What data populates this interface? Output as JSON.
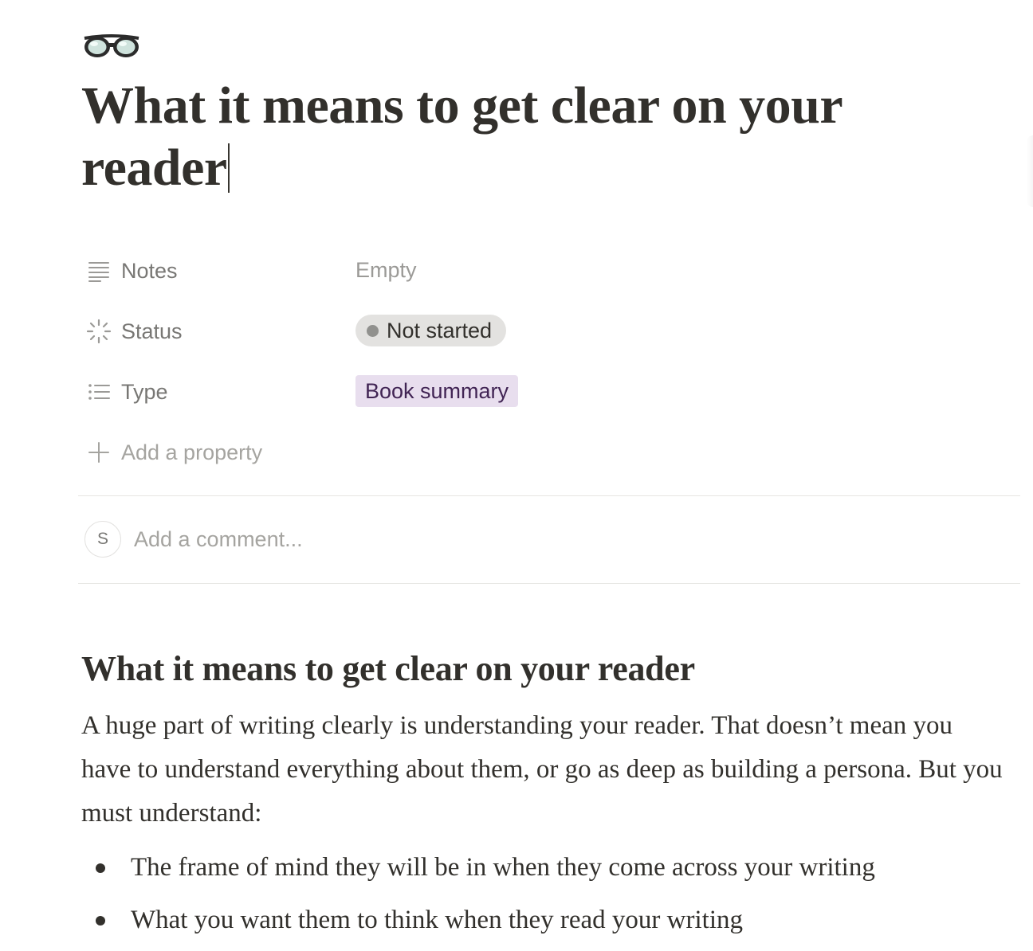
{
  "page": {
    "icon": "eyeglasses-icon",
    "title": "What it means to get clear on your reader"
  },
  "properties": [
    {
      "icon": "text-lines-icon",
      "name": "Notes",
      "value": "Empty"
    },
    {
      "icon": "status-spinner-icon",
      "name": "Status",
      "value": "Not started"
    },
    {
      "icon": "bulleted-list-icon",
      "name": "Type",
      "value": "Book summary"
    }
  ],
  "add_property": {
    "icon": "plus-icon",
    "label": "Add a property"
  },
  "comment": {
    "avatar_initial": "S",
    "placeholder": "Add a comment..."
  },
  "content": {
    "heading": "What it means to get clear on your reader",
    "paragraph": "A huge part of writing clearly is understanding your reader. That doesn’t mean you have to understand everything about them, or go as deep as building a persona. But you must understand:",
    "bullets": [
      "The frame of mind they will be in when they come across your writing",
      "What you want them to think when they read your writing"
    ]
  },
  "colors": {
    "status_pill_bg": "#e3e2e0",
    "status_dot": "#91918e",
    "type_tag_bg": "#e8deee",
    "type_tag_text": "#412454"
  }
}
